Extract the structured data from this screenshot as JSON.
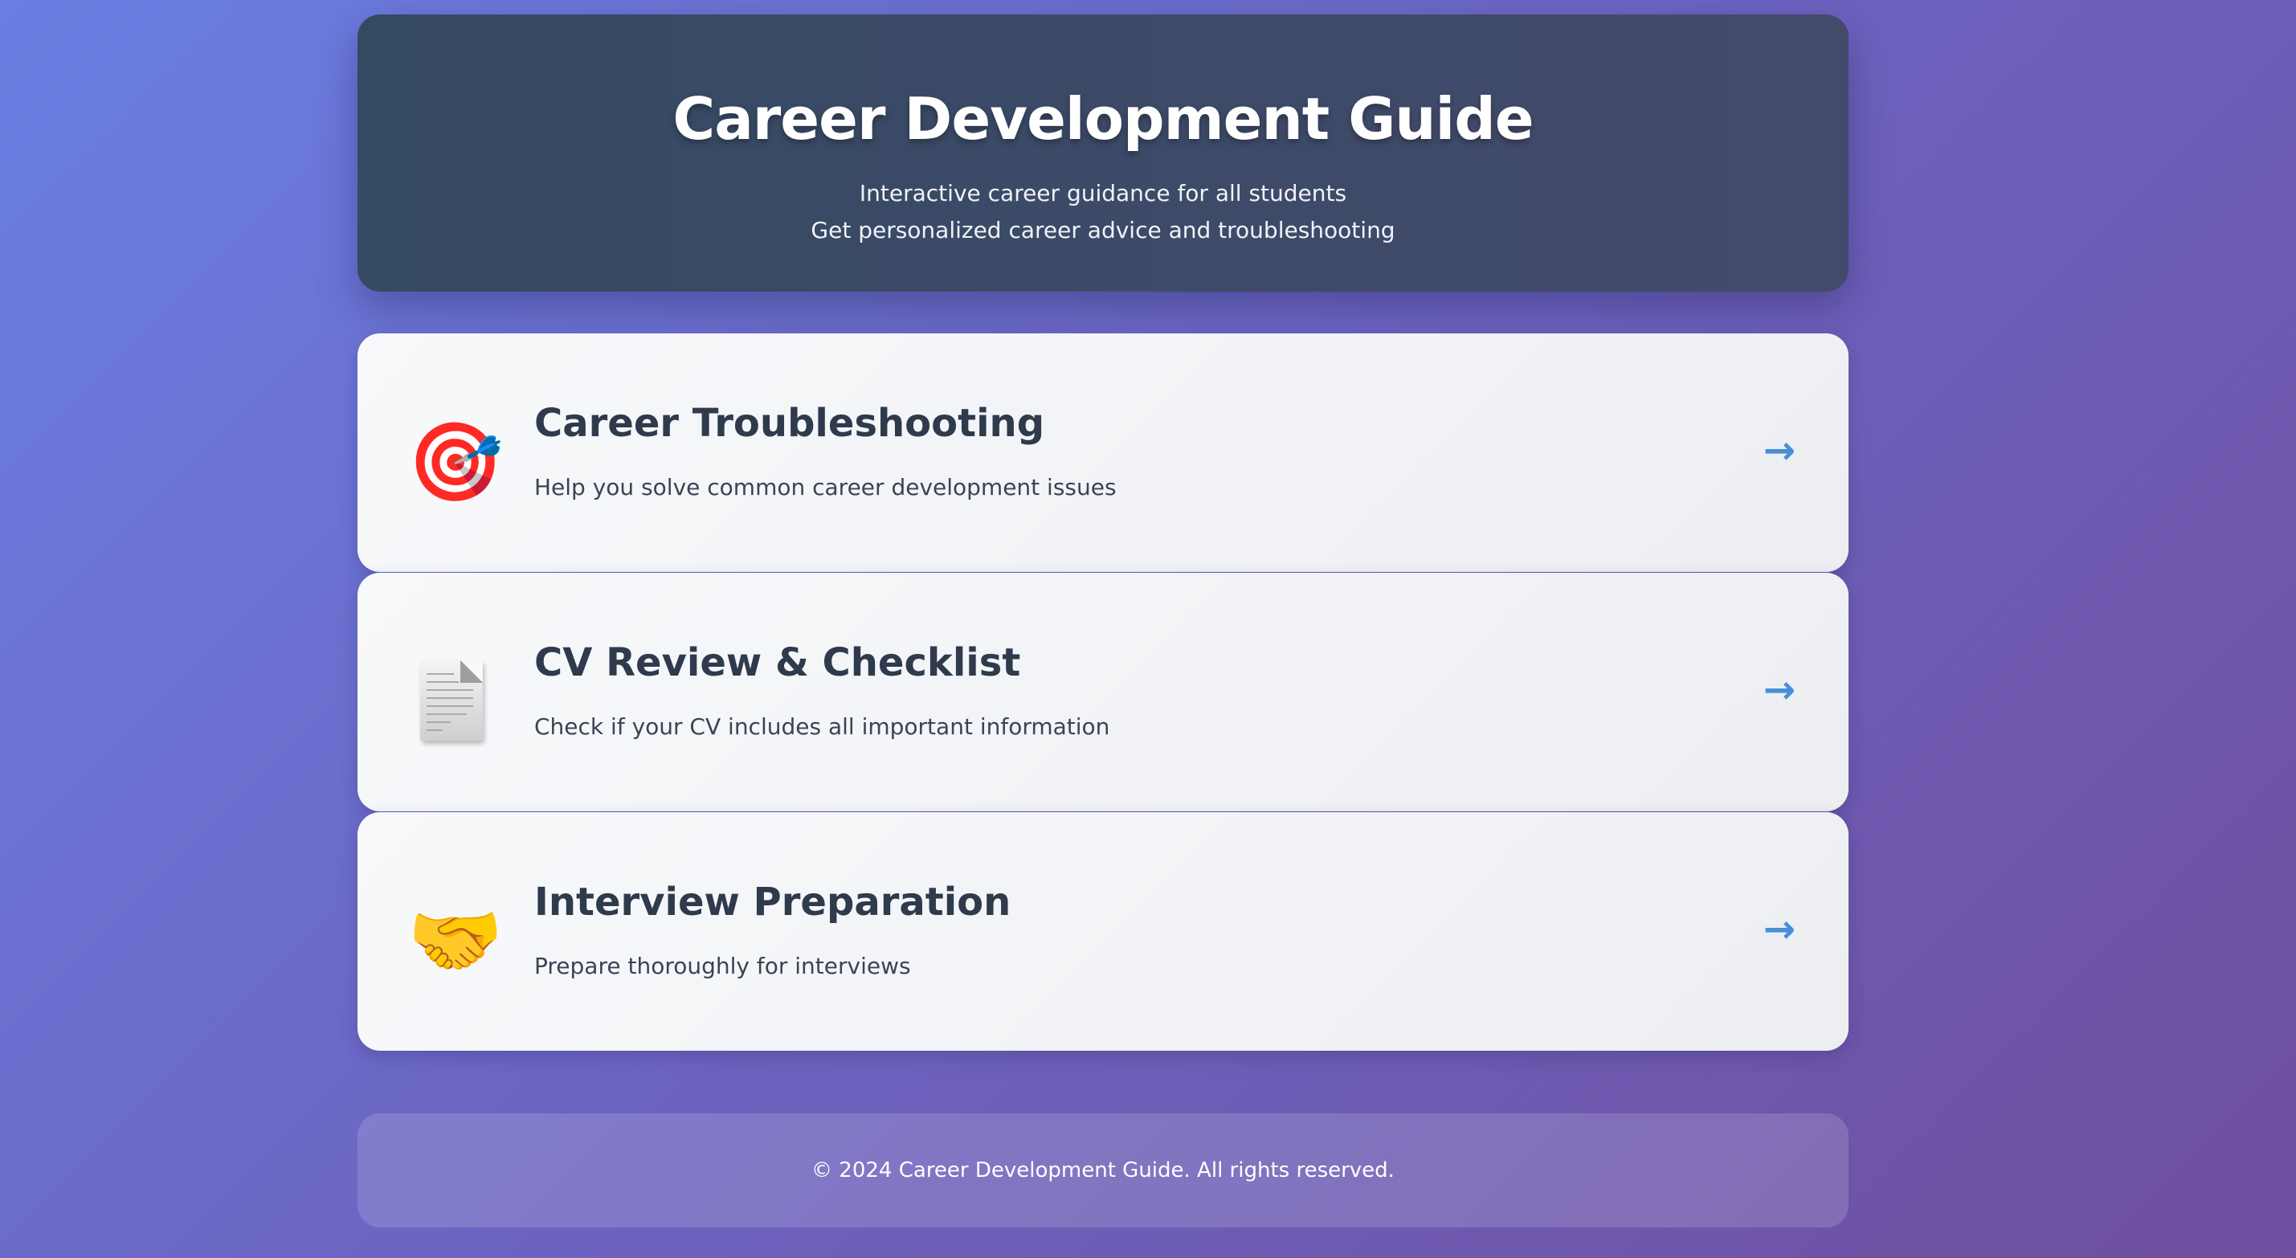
{
  "header": {
    "title": "Career Development Guide",
    "subtitle_line1": "Interactive career guidance for all students",
    "subtitle_line2": "Get personalized career advice and troubleshooting"
  },
  "cards": [
    {
      "icon": "🎯",
      "icon_name": "target-icon",
      "title": "Career Troubleshooting",
      "description": "Help you solve common career development issues",
      "arrow": "→"
    },
    {
      "icon": "📄",
      "icon_name": "document-icon",
      "title": "CV Review & Checklist",
      "description": "Check if your CV includes all important information",
      "arrow": "→"
    },
    {
      "icon": "🤝",
      "icon_name": "handshake-icon",
      "title": "Interview Preparation",
      "description": "Prepare thoroughly for interviews",
      "arrow": "→"
    }
  ],
  "footer": {
    "text": "© 2024 Career Development Guide. All rights reserved."
  },
  "colors": {
    "header_bg": "#3b4a65",
    "card_title": "#2f3b4c",
    "arrow": "#4a8fd6"
  }
}
